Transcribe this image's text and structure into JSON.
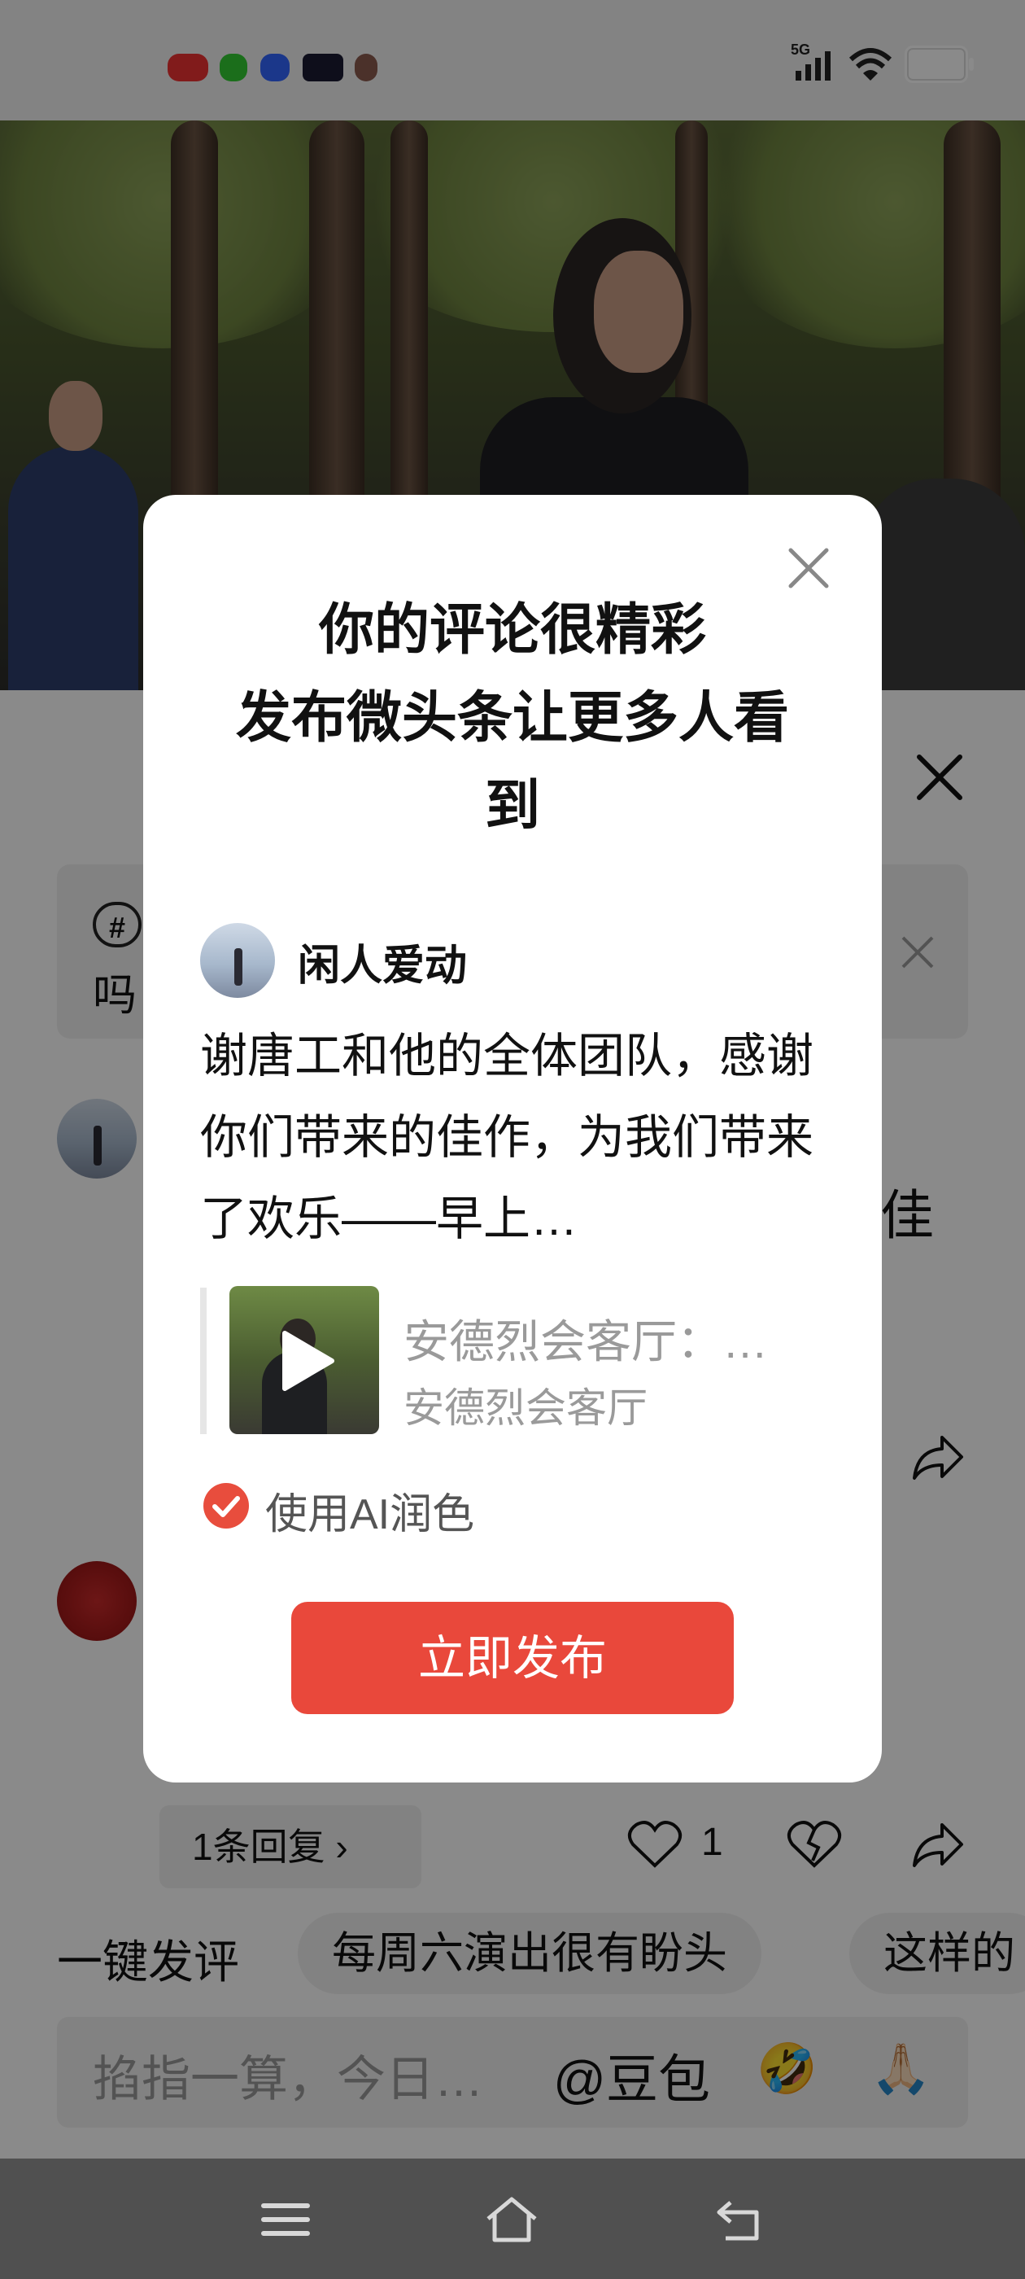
{
  "status_bar": {
    "network": "5G",
    "icons": [
      "signal-icon",
      "wifi-icon",
      "battery-icon"
    ]
  },
  "video": {
    "scene": "outdoor-performance"
  },
  "comment_sheet": {
    "topic_prefix_char": "吗",
    "background_partial_char": "佳",
    "reply_count_label": "1条回复 ›",
    "like_count": "1",
    "quick_comment_label": "一键发评",
    "chips": [
      "每周六演出很有盼头",
      "这样的"
    ],
    "input_placeholder": "掐指一算，今日…",
    "mention": "@豆包",
    "emojis": [
      "🤣",
      "🙏🏻"
    ]
  },
  "dialog": {
    "title_line1": "你的评论很精彩",
    "title_line2": "发布微头条让更多人看",
    "title_line3": "到",
    "user_name": "闲人爱动",
    "comment_text": "谢唐工和他的全体团队，感谢你们带来的佳作，为我们带来了欢乐——早上…",
    "card_title": "安德烈会客厅：…",
    "card_subtitle": "安德烈会客厅",
    "ai_label": "使用AI润色",
    "ai_checked": true,
    "publish_label": "立即发布",
    "accent_color": "#e9483b"
  },
  "nav_bar": {
    "icons": [
      "menu-icon",
      "home-icon",
      "back-icon"
    ]
  }
}
